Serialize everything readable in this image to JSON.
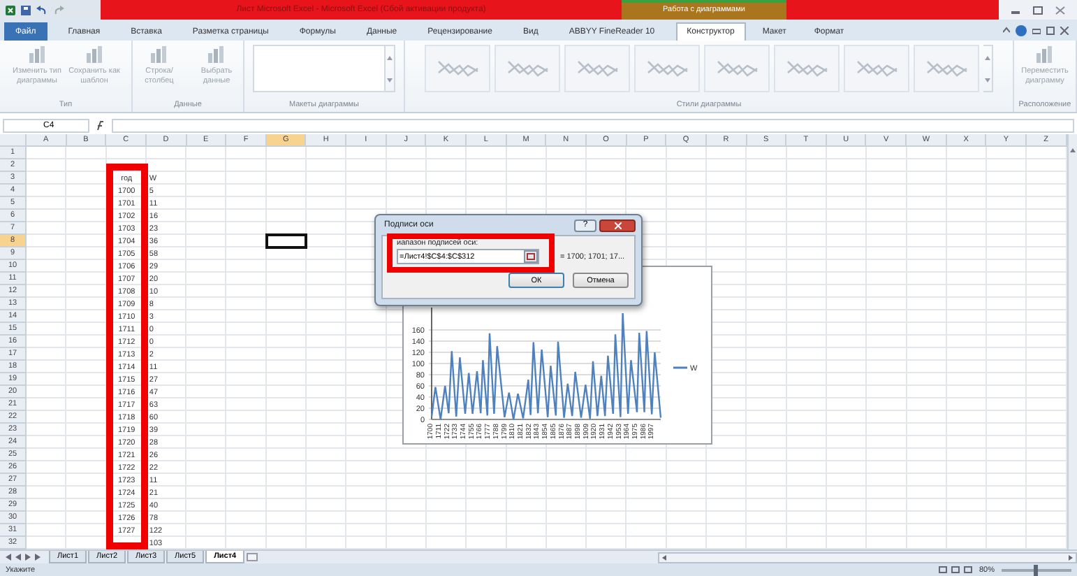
{
  "window": {
    "title": "Лист Microsoft Excel  -  Microsoft Excel (Сбой активации продукта)",
    "context_group": "Работа с диаграммами"
  },
  "ribbon_tabs": [
    {
      "label": "Файл",
      "kind": "file",
      "selected": false
    },
    {
      "label": "Главная",
      "kind": "tab",
      "selected": false
    },
    {
      "label": "Вставка",
      "kind": "tab",
      "selected": false
    },
    {
      "label": "Разметка страницы",
      "kind": "tab",
      "selected": false
    },
    {
      "label": "Формулы",
      "kind": "tab",
      "selected": false
    },
    {
      "label": "Данные",
      "kind": "tab",
      "selected": false
    },
    {
      "label": "Рецензирование",
      "kind": "tab",
      "selected": false
    },
    {
      "label": "Вид",
      "kind": "tab",
      "selected": false
    },
    {
      "label": "ABBYY FineReader 10",
      "kind": "tab",
      "selected": false
    },
    {
      "label": "Конструктор",
      "kind": "context",
      "selected": true
    },
    {
      "label": "Макет",
      "kind": "context",
      "selected": false
    },
    {
      "label": "Формат",
      "kind": "context",
      "selected": false
    }
  ],
  "ribbon_groups": [
    {
      "title": "Тип",
      "kind": "buttons",
      "buttons": [
        {
          "label": "Изменить тип диаграммы",
          "disabled": true
        },
        {
          "label": "Сохранить как шаблон",
          "disabled": true
        }
      ]
    },
    {
      "title": "Данные",
      "kind": "buttons",
      "buttons": [
        {
          "label": "Строка/столбец",
          "disabled": true
        },
        {
          "label": "Выбрать данные",
          "disabled": true
        }
      ]
    },
    {
      "title": "Макеты диаграммы",
      "kind": "gallery"
    },
    {
      "title": "Стили диаграммы",
      "kind": "styles"
    },
    {
      "title": "Расположение",
      "kind": "buttons",
      "buttons": [
        {
          "label": "Переместить диаграмму",
          "disabled": true
        }
      ]
    }
  ],
  "name_box": "C4",
  "columns": [
    {
      "label": "A",
      "selected": false
    },
    {
      "label": "B",
      "selected": false
    },
    {
      "label": "C",
      "selected": false
    },
    {
      "label": "D",
      "selected": false
    },
    {
      "label": "E",
      "selected": false
    },
    {
      "label": "F",
      "selected": false
    },
    {
      "label": "G",
      "selected": true
    },
    {
      "label": "H",
      "selected": false
    },
    {
      "label": "I",
      "selected": false
    },
    {
      "label": "J",
      "selected": false
    },
    {
      "label": "K",
      "selected": false
    },
    {
      "label": "L",
      "selected": false
    },
    {
      "label": "M",
      "selected": false
    },
    {
      "label": "N",
      "selected": false
    },
    {
      "label": "O",
      "selected": false
    },
    {
      "label": "P",
      "selected": false
    },
    {
      "label": "Q",
      "selected": false
    },
    {
      "label": "R",
      "selected": false
    },
    {
      "label": "S",
      "selected": false
    },
    {
      "label": "T",
      "selected": false
    },
    {
      "label": "U",
      "selected": false
    },
    {
      "label": "V",
      "selected": false
    },
    {
      "label": "W",
      "selected": false
    },
    {
      "label": "X",
      "selected": false
    },
    {
      "label": "Y",
      "selected": false
    },
    {
      "label": "Z",
      "selected": false
    }
  ],
  "rows": [
    {
      "header": "1",
      "selected": false
    },
    {
      "header": "2",
      "selected": false
    },
    {
      "header": "3",
      "selected": false,
      "C": "год",
      "D": "W"
    },
    {
      "header": "4",
      "selected": false,
      "C": "1700",
      "D": "5"
    },
    {
      "header": "5",
      "selected": false,
      "C": "1701",
      "D": "11"
    },
    {
      "header": "6",
      "selected": false,
      "C": "1702",
      "D": "16"
    },
    {
      "header": "7",
      "selected": false,
      "C": "1703",
      "D": "23"
    },
    {
      "header": "8",
      "selected": true,
      "C": "1704",
      "D": "36"
    },
    {
      "header": "9",
      "selected": false,
      "C": "1705",
      "D": "58"
    },
    {
      "header": "10",
      "selected": false,
      "C": "1706",
      "D": "29"
    },
    {
      "header": "11",
      "selected": false,
      "C": "1707",
      "D": "20"
    },
    {
      "header": "12",
      "selected": false,
      "C": "1708",
      "D": "10"
    },
    {
      "header": "13",
      "selected": false,
      "C": "1709",
      "D": "8"
    },
    {
      "header": "14",
      "selected": false,
      "C": "1710",
      "D": "3"
    },
    {
      "header": "15",
      "selected": false,
      "C": "1711",
      "D": "0"
    },
    {
      "header": "16",
      "selected": false,
      "C": "1712",
      "D": "0"
    },
    {
      "header": "17",
      "selected": false,
      "C": "1713",
      "D": "2"
    },
    {
      "header": "18",
      "selected": false,
      "C": "1714",
      "D": "11"
    },
    {
      "header": "19",
      "selected": false,
      "C": "1715",
      "D": "27"
    },
    {
      "header": "20",
      "selected": false,
      "C": "1716",
      "D": "47"
    },
    {
      "header": "21",
      "selected": false,
      "C": "1717",
      "D": "63"
    },
    {
      "header": "22",
      "selected": false,
      "C": "1718",
      "D": "60"
    },
    {
      "header": "23",
      "selected": false,
      "C": "1719",
      "D": "39"
    },
    {
      "header": "24",
      "selected": false,
      "C": "1720",
      "D": "28"
    },
    {
      "header": "25",
      "selected": false,
      "C": "1721",
      "D": "26"
    },
    {
      "header": "26",
      "selected": false,
      "C": "1722",
      "D": "22"
    },
    {
      "header": "27",
      "selected": false,
      "C": "1723",
      "D": "11"
    },
    {
      "header": "28",
      "selected": false,
      "C": "1724",
      "D": "21"
    },
    {
      "header": "29",
      "selected": false,
      "C": "1725",
      "D": "40"
    },
    {
      "header": "30",
      "selected": false,
      "C": "1726",
      "D": "78"
    },
    {
      "header": "31",
      "selected": false,
      "C": "1727",
      "D": "122"
    },
    {
      "header": "32",
      "selected": false,
      "D": "103"
    }
  ],
  "chart": {
    "chart_data": {
      "type": "line",
      "x": [
        1700,
        1705,
        1712,
        1718,
        1723,
        1727,
        1733,
        1738,
        1745,
        1750,
        1755,
        1761,
        1766,
        1769,
        1775,
        1778,
        1784,
        1788,
        1798,
        1804,
        1810,
        1816,
        1823,
        1830,
        1833,
        1837,
        1843,
        1848,
        1856,
        1860,
        1867,
        1870,
        1878,
        1883,
        1889,
        1893,
        1901,
        1907,
        1913,
        1917,
        1923,
        1928,
        1933,
        1937,
        1944,
        1947,
        1954,
        1957,
        1964,
        1968,
        1976,
        1979,
        1986,
        1989,
        1996,
        2000,
        2008
      ],
      "series": [
        {
          "name": "W",
          "color": "#4f81bd",
          "values": [
            5,
            58,
            0,
            60,
            11,
            122,
            5,
            111,
            10,
            83,
            10,
            86,
            11,
            106,
            7,
            154,
            10,
            131,
            4,
            48,
            0,
            46,
            2,
            71,
            8,
            138,
            11,
            125,
            4,
            96,
            7,
            139,
            3,
            64,
            6,
            85,
            3,
            62,
            1,
            104,
            6,
            78,
            6,
            114,
            10,
            152,
            4,
            190,
            10,
            106,
            13,
            155,
            13,
            158,
            9,
            120,
            3
          ]
        }
      ],
      "xlim": [
        1700,
        2008
      ],
      "ylim": [
        0,
        200
      ],
      "grid": true,
      "yticks": [
        0,
        20,
        40,
        60,
        80,
        100,
        120,
        140,
        160
      ],
      "xticks": [
        1700,
        1711,
        1722,
        1733,
        1744,
        1755,
        1766,
        1777,
        1788,
        1799,
        1810,
        1821,
        1832,
        1843,
        1854,
        1865,
        1876,
        1887,
        1898,
        1909,
        1920,
        1931,
        1942,
        1953,
        1964,
        1975,
        1986,
        1997
      ]
    }
  },
  "dialog": {
    "title": "Подписи оси",
    "help": "?",
    "label": "иапазон подписей оси:",
    "value": "=Лист4!$C$4:$C$312",
    "preview": "= 1700; 1701; 17...",
    "buttons": [
      {
        "label": "ОК",
        "kind": "default"
      },
      {
        "label": "Отмена",
        "kind": "normal"
      }
    ]
  },
  "sheet_tabs": [
    {
      "label": "Лист1",
      "selected": false
    },
    {
      "label": "Лист2",
      "selected": false
    },
    {
      "label": "Лист3",
      "selected": false
    },
    {
      "label": "Лист5",
      "selected": false
    },
    {
      "label": "Лист4",
      "selected": true
    }
  ],
  "status_bar": {
    "mode": "Укажите",
    "zoom": "80%",
    "zoom_slider": {
      "level": 0.45
    }
  }
}
